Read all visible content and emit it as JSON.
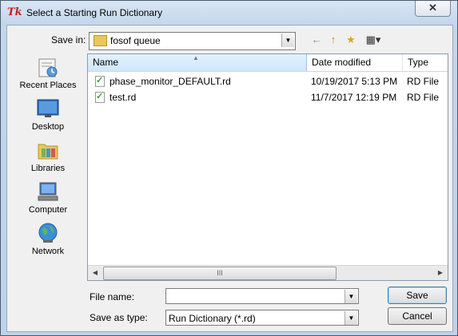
{
  "window": {
    "title": "Select a Starting Run Dictionary",
    "close_symbol": "✕",
    "app_icon": "tk-icon"
  },
  "save_in": {
    "label": "Save in:",
    "value": "fosof queue"
  },
  "toolbar": {
    "back": "←",
    "up": "↑",
    "new_folder": "★",
    "views": "▦▾"
  },
  "places": [
    {
      "label": "Recent Places",
      "icon": "recent-places-icon"
    },
    {
      "label": "Desktop",
      "icon": "desktop-icon"
    },
    {
      "label": "Libraries",
      "icon": "libraries-icon"
    },
    {
      "label": "Computer",
      "icon": "computer-icon"
    },
    {
      "label": "Network",
      "icon": "network-icon"
    }
  ],
  "columns": {
    "name": "Name",
    "date": "Date modified",
    "type": "Type"
  },
  "files": [
    {
      "name": "phase_monitor_DEFAULT.rd",
      "date": "10/19/2017 5:13 PM",
      "type": "RD File"
    },
    {
      "name": "test.rd",
      "date": "11/7/2017 12:19 PM",
      "type": "RD File"
    }
  ],
  "scrollbar": {
    "left": "◀",
    "right": "▶",
    "grip": "III"
  },
  "file_name": {
    "label": "File name:",
    "value": ""
  },
  "save_type": {
    "label": "Save as type:",
    "value": "Run Dictionary (*.rd)"
  },
  "buttons": {
    "save": "Save",
    "cancel": "Cancel"
  },
  "dropdown_arrow": "▼"
}
